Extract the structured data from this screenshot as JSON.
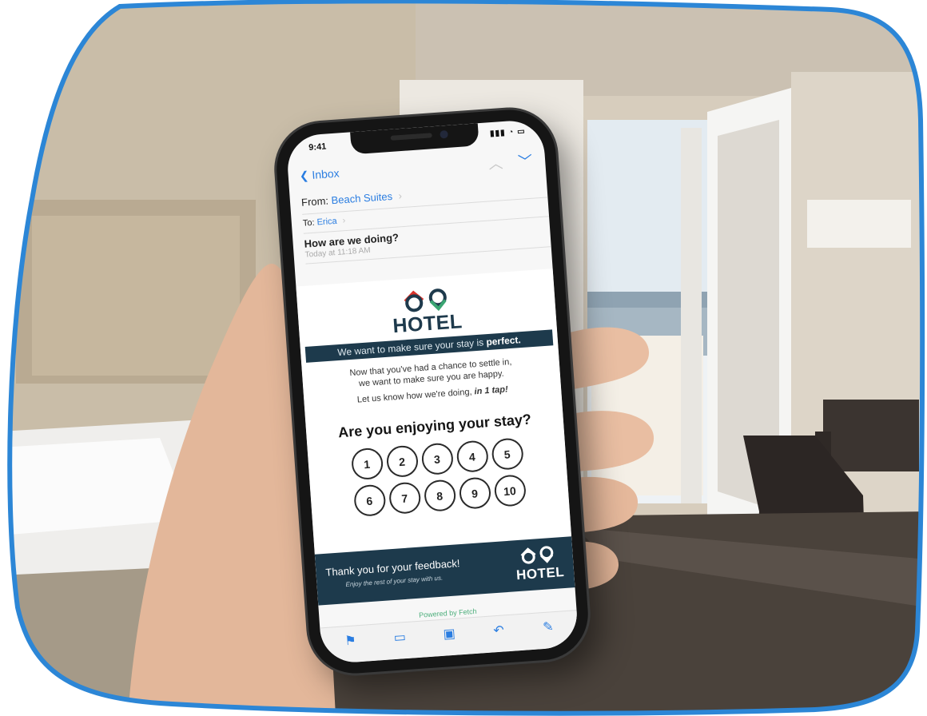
{
  "status_bar": {
    "time": "9:41"
  },
  "nav": {
    "back_label": "Inbox",
    "prev_icon": "chevron-up-icon",
    "next_icon": "chevron-down-icon"
  },
  "email_header": {
    "from_label": "From:",
    "from_name": "Beach Suites",
    "to_label": "To:",
    "to_name": "Erica",
    "subject": "How are we doing?",
    "timestamp": "Today at 11:18 AM"
  },
  "email_body": {
    "brand": "HOTEL",
    "banner_text": "We want to make sure your stay is",
    "banner_emphasis": "perfect.",
    "line1": "Now that you've had a chance to settle in,",
    "line2": "we want to make sure you are happy.",
    "line3": "Let us know how we're doing,",
    "line3_emphasis": "in 1 tap!",
    "question": "Are you enjoying your stay?",
    "ratings_row1": [
      "1",
      "2",
      "3",
      "4",
      "5"
    ],
    "ratings_row2": [
      "6",
      "7",
      "8",
      "9",
      "10"
    ]
  },
  "footer": {
    "thanks": "Thank you for your feedback!",
    "subtext": "Enjoy the rest of your stay with us.",
    "brand": "HOTEL",
    "powered_by": "Powered by Fetch"
  },
  "toolbar": {
    "icons": [
      "flag-icon",
      "folder-icon",
      "archive-icon",
      "reply-icon",
      "compose-icon"
    ]
  },
  "colors": {
    "accent_blue": "#2a7de1",
    "brand_navy": "#1d3a4c",
    "logo_red": "#d9342b",
    "logo_green": "#3aa572",
    "frame_blue": "#2c86d6"
  }
}
